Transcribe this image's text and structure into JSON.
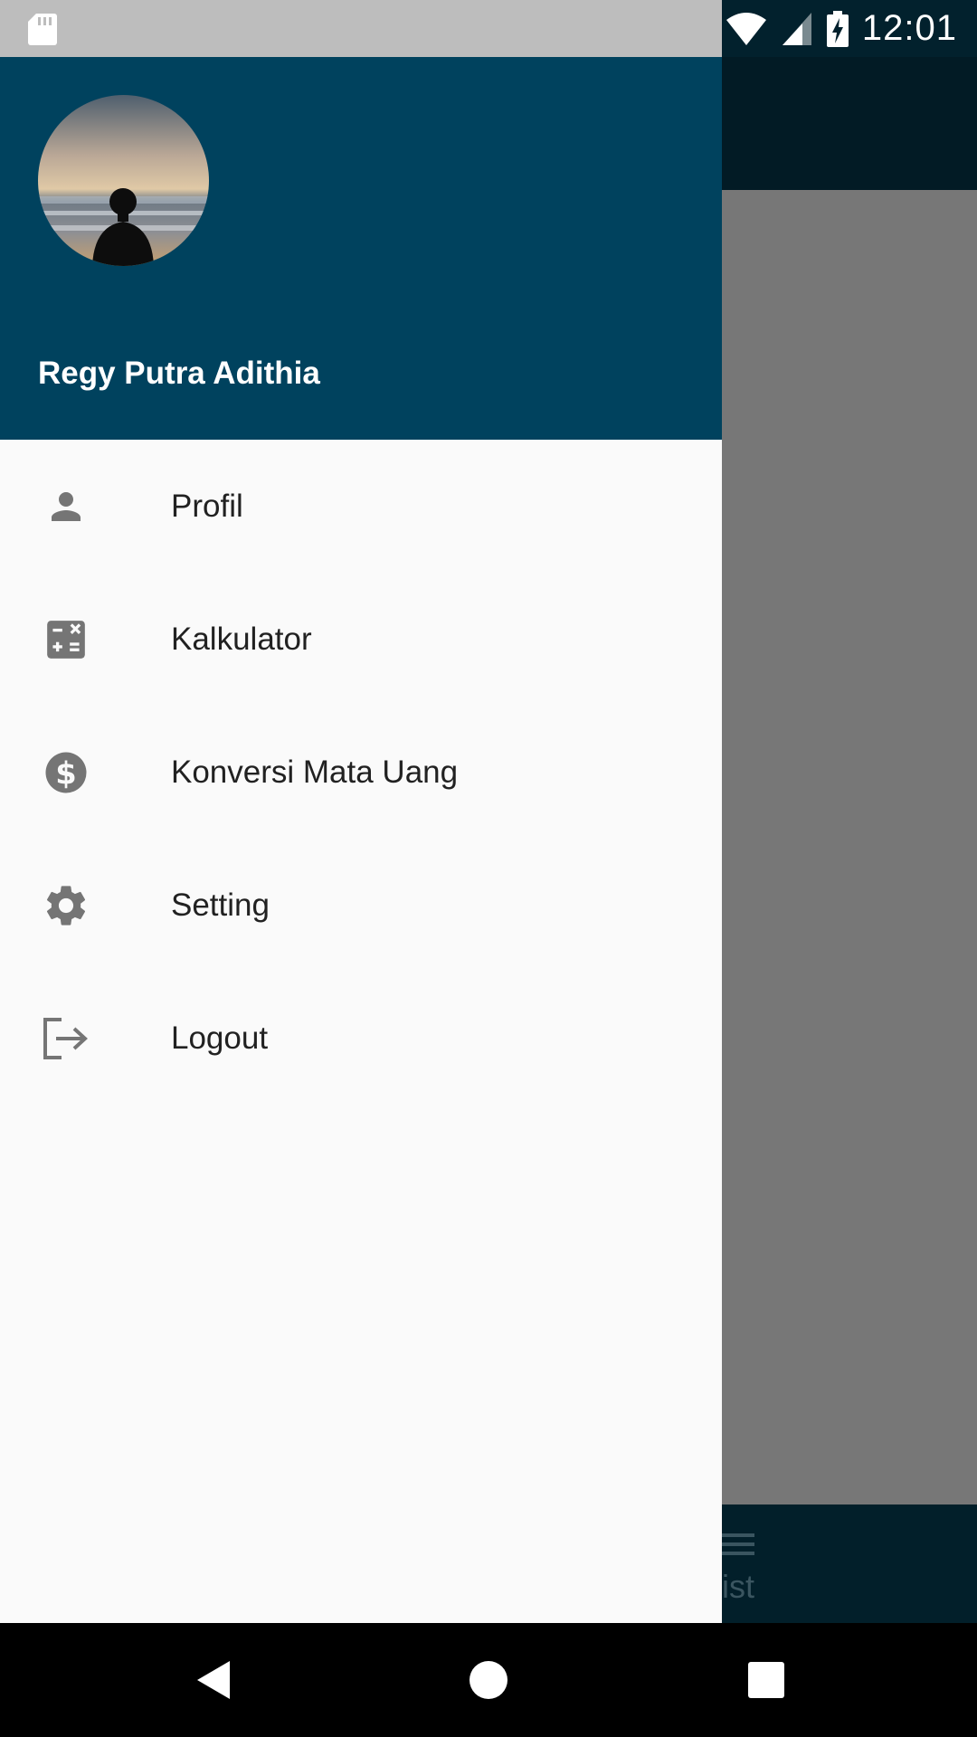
{
  "status_bar": {
    "time": "12:01",
    "icons": [
      "sd-card-icon",
      "wifi-icon",
      "signal-icon",
      "battery-charging-icon"
    ]
  },
  "drawer": {
    "user_name": "Regy Putra Adithia",
    "menu": [
      {
        "label": "Profil",
        "icon": "person-icon"
      },
      {
        "label": "Kalkulator",
        "icon": "calculator-icon"
      },
      {
        "label": "Konversi Mata Uang",
        "icon": "dollar-icon"
      },
      {
        "label": "Setting",
        "icon": "gear-icon"
      },
      {
        "label": "Logout",
        "icon": "logout-icon"
      }
    ]
  },
  "background_app": {
    "bottom_nav_label": "ist"
  },
  "colors": {
    "header": "#00425e",
    "drawer_bg": "#fafafa",
    "icon": "#757575",
    "scrim": "#777777"
  }
}
